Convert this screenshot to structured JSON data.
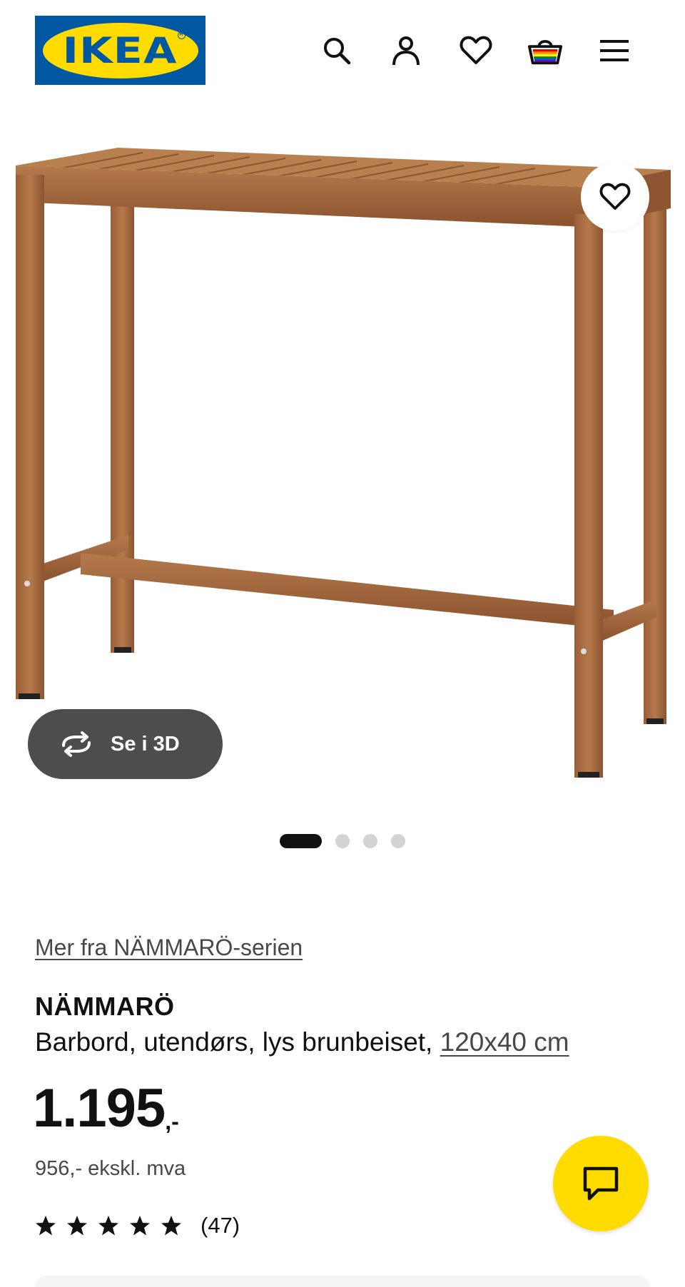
{
  "header": {
    "logo_text": "IKEA",
    "icons": [
      "search-icon",
      "account-icon",
      "heart-icon",
      "basket-icon",
      "menu-icon"
    ]
  },
  "gallery": {
    "see_3d_label": "Se i 3D",
    "slide_count": 4,
    "active_slide": 1
  },
  "product": {
    "series_link": "Mer fra NÄMMARÖ-serien",
    "name": "NÄMMARÖ",
    "description": "Barbord, utendørs, lys brunbeiset,",
    "size_link": "120x40 cm",
    "price_main": "1.195",
    "price_suffix": ",-",
    "price_excl_vat": "956,- ekskl. mva",
    "rating_stars": 5,
    "rating_count": "(47)"
  },
  "colors": {
    "brand_blue": "#0058a3",
    "brand_yellow": "#ffdb00",
    "wood": "#a0663c"
  }
}
